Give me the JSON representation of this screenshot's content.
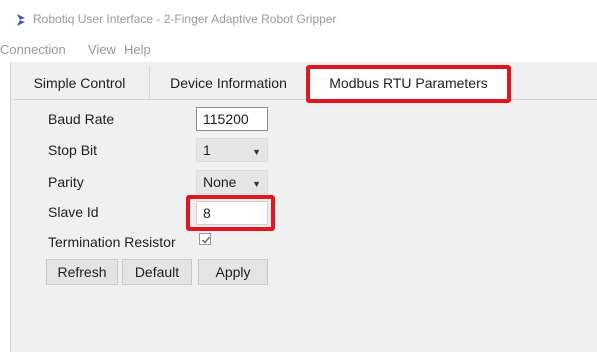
{
  "window": {
    "title": "Robotiq User Interface - 2-Finger Adaptive Robot Gripper",
    "app_icon": "robotiq-logo-icon",
    "accent_color": "#e3161e"
  },
  "menubar": {
    "items": [
      {
        "label": "Connection"
      },
      {
        "label": "View"
      },
      {
        "label": "Help"
      }
    ]
  },
  "tabs": [
    {
      "label": "Simple Control",
      "active": false
    },
    {
      "label": "Device Information",
      "active": false
    },
    {
      "label": "Modbus RTU Parameters",
      "active": true
    }
  ],
  "form": {
    "baud_rate": {
      "label": "Baud Rate",
      "value": "115200"
    },
    "stop_bit": {
      "label": "Stop Bit",
      "value": "1"
    },
    "parity": {
      "label": "Parity",
      "value": "None"
    },
    "slave_id": {
      "label": "Slave Id",
      "value": "8"
    },
    "termination_resistor": {
      "label": "Termination Resistor",
      "checked": true
    }
  },
  "buttons": {
    "refresh": "Refresh",
    "default": "Default",
    "apply": "Apply"
  }
}
